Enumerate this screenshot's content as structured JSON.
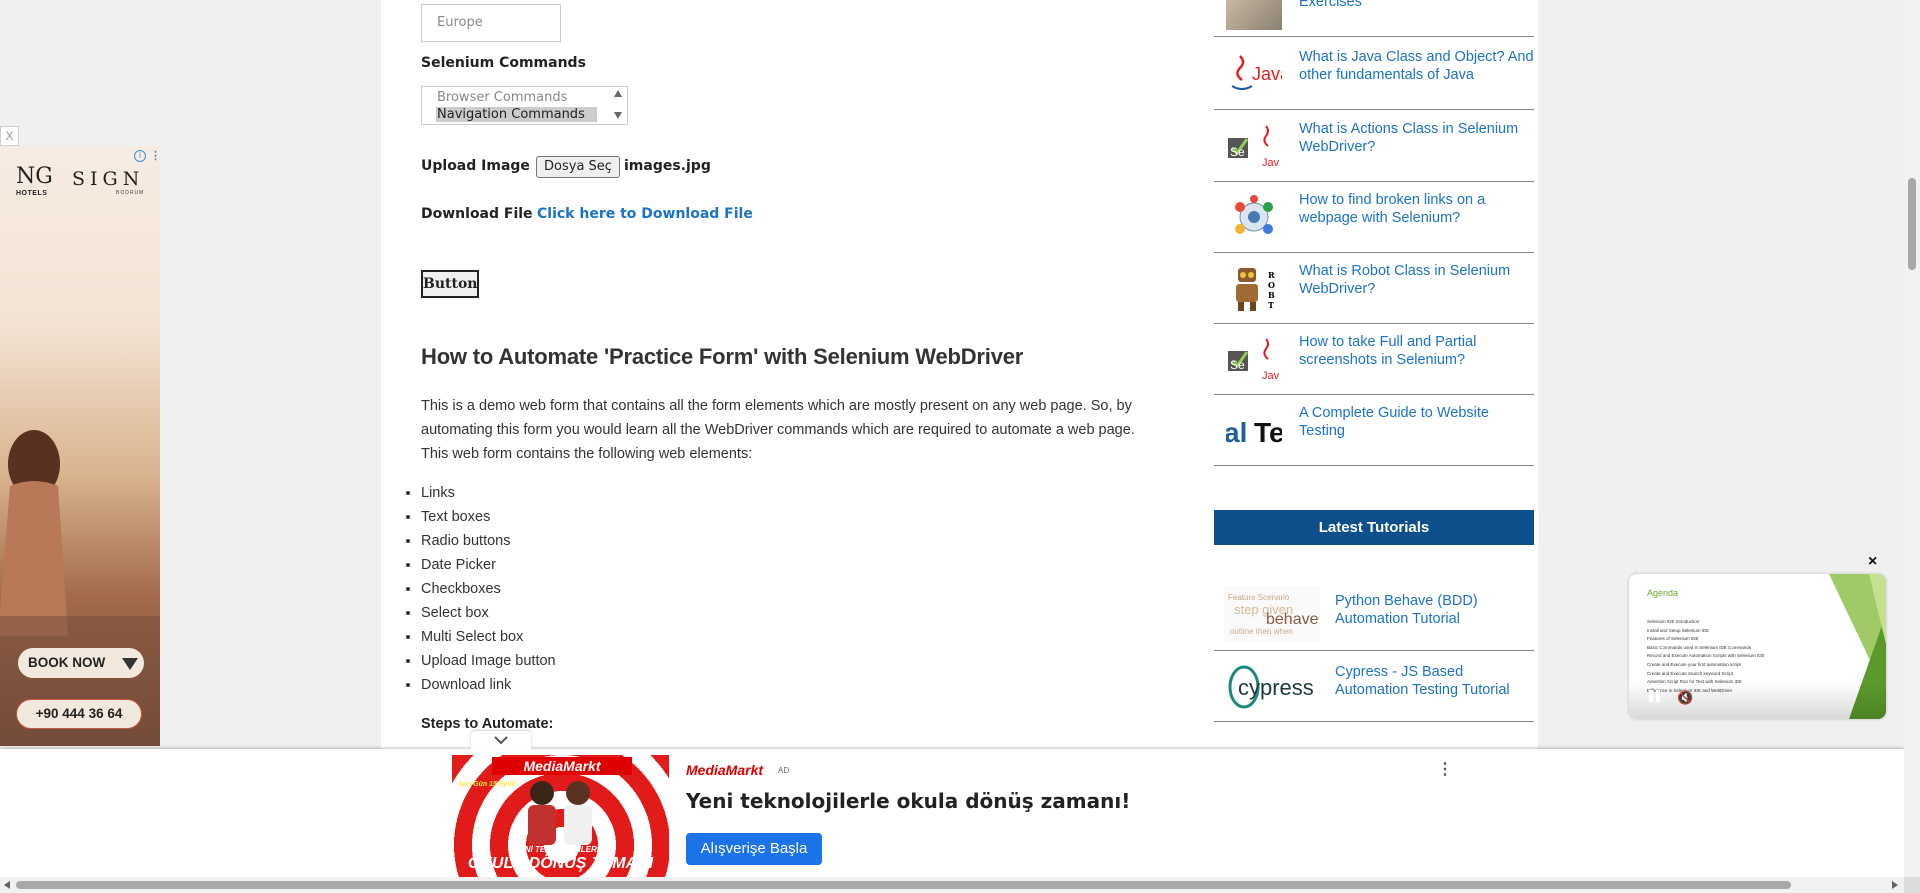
{
  "form": {
    "continent_value": "Europe",
    "selenium_commands_label": "Selenium Commands",
    "commands_options": [
      "Browser Commands",
      "Navigation Commands"
    ],
    "upload_label": "Upload Image",
    "upload_button": "Dosya Seç",
    "upload_filename": "images.jpg",
    "download_label": "Download File",
    "download_link": "Click here to Download File",
    "button_label": "Button"
  },
  "article": {
    "heading": "How to Automate 'Practice Form' with Selenium WebDriver",
    "intro": "This is a demo web form that contains all the form elements which are mostly present on any web page. So, by automating this form you would learn all the WebDriver commands which are required to automate a web page. This web form contains the following web elements:",
    "elements": [
      "Links",
      "Text boxes",
      "Radio buttons",
      "Date Picker",
      "Checkboxes",
      "Select box",
      "Multi Select box",
      "Upload Image button",
      "Download link"
    ],
    "steps_heading": "Steps to Automate:"
  },
  "sidebar": {
    "partial_item": "Exercises",
    "related": [
      {
        "title": "What is Java Class and Object? And other fundamentals of Java",
        "icon": "java-icon"
      },
      {
        "title": "What is Actions Class in Selenium WebDriver?",
        "icon": "selenium-java-icon"
      },
      {
        "title": "How to find broken links on a webpage with Selenium?",
        "icon": "broken-links-icon"
      },
      {
        "title": "What is Robot Class in Selenium WebDriver?",
        "icon": "robot-icon"
      },
      {
        "title": "How to take Full and Partial screenshots in Selenium?",
        "icon": "selenium-java-icon"
      },
      {
        "title": "A Complete Guide to Website Testing",
        "icon": "website-testing-icon"
      }
    ],
    "latest_heading": "Latest Tutorials",
    "latest": [
      {
        "title": "Python Behave (BDD) Automation Tutorial",
        "thumb_text": "behave"
      },
      {
        "title": "Cypress - JS Based Automation Testing Tutorial",
        "thumb_text": "cypress"
      }
    ]
  },
  "left_ad": {
    "close": "X",
    "brand_ng": "NG",
    "brand_hotels": "HOTELS",
    "brand_sign": "SIGN",
    "brand_sub": "BODRUM",
    "book_now": "BOOK NOW",
    "phone": "+90 444 36 64"
  },
  "video_ad": {
    "close": "×",
    "title": "Agenda",
    "lines": [
      "Selenium IDE Introduction",
      "Install and Setup Selenium IDE",
      "Features of Selenium IDE",
      "Basic Commands used in Selenium IDE Commands",
      "Record and Execute Automation Scripts with Selenium IDE",
      "Create and Execute your first automation script",
      "Create and Execute Search keyword Script",
      "Assertion Script Run for Test with Selenium IDE",
      "Difference in Selenium IDE and WebDriver"
    ]
  },
  "bottom_ad": {
    "brand": "MediaMarkt",
    "ad_badge": "AD",
    "headline": "Yeni teknolojilerle okula dönüş zamanı!",
    "cta": "Alışverişe Başla",
    "img_tag": "Son Gün 15 Eylül",
    "img_line1": "YENİ TEKNOLOJİLERLE",
    "img_line2": "OKULA DÖNÜŞ ZAMANI"
  },
  "colors": {
    "link": "#1a73c8",
    "latest_header_bg": "#0d4f8b",
    "cta_blue": "#1a73e8",
    "mediamarkt_red": "#df0000"
  }
}
